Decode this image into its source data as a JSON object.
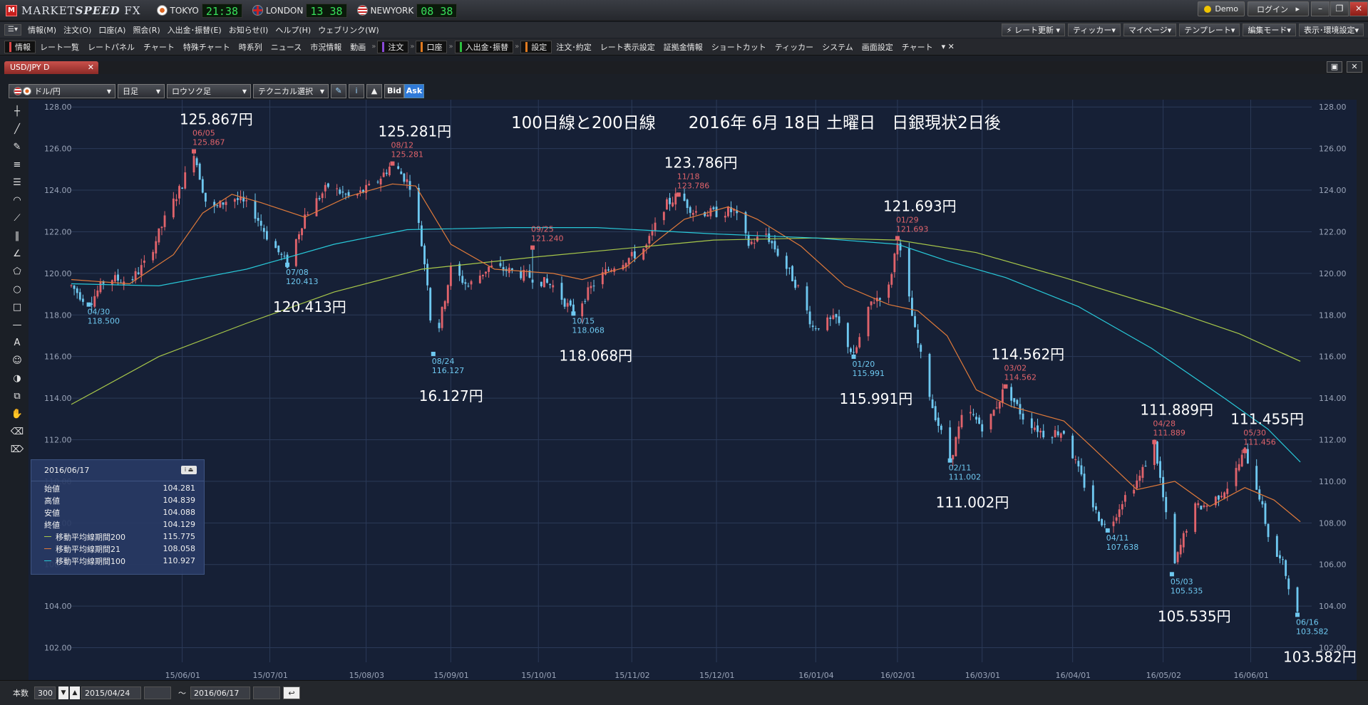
{
  "app": {
    "logo_text": "M",
    "brand_prefix": "MARKET",
    "brand_mid": "SPEED",
    "brand_suffix": " FX",
    "markets": [
      {
        "name": "TOKYO",
        "time": "21:38",
        "flag": "jp"
      },
      {
        "name": "LONDON",
        "time": "13 38",
        "flag": "uk"
      },
      {
        "name": "NEWYORK",
        "time": "08 38",
        "flag": "us"
      }
    ],
    "demo_label": "Demo",
    "login_label": "ログイン",
    "login_arrow": "▸",
    "window_buttons": [
      "–",
      "❐",
      "✕"
    ]
  },
  "menu": {
    "icon": "☰▾",
    "items": [
      "情報(M)",
      "注文(O)",
      "口座(A)",
      "照会(R)",
      "入出金･振替(E)",
      "お知らせ(I)",
      "ヘルプ(H)",
      "ウェブリンク(W)"
    ],
    "right_buttons": [
      "⚡ レート更新 ▾",
      "ティッカー▾",
      "マイページ▾",
      "テンプレート▾",
      "編集モード▾",
      "表示･環境設定▾"
    ]
  },
  "toolbar": {
    "groups": [
      {
        "label": "情報",
        "bar": "#e04848",
        "hl": true
      },
      {
        "label": "レート一覧"
      },
      {
        "label": "レートパネル"
      },
      {
        "label": "チャート"
      },
      {
        "label": "特殊チャート"
      },
      {
        "label": "時系列"
      },
      {
        "label": "ニュース"
      },
      {
        "label": "市況情報"
      },
      {
        "label": "動画"
      },
      {
        "label": "注文",
        "bar": "#8a4ad8",
        "hl": true,
        "sep": true
      },
      {
        "label": "口座",
        "bar": "#e07a20",
        "hl": true,
        "sep": true
      },
      {
        "label": "入出金･振替",
        "bar": "#2cc040",
        "hl": true,
        "sep": true
      },
      {
        "label": "設定",
        "bar": "#e07a20",
        "hl": true,
        "sep": true
      },
      {
        "label": "注文･約定"
      },
      {
        "label": "レート表示設定"
      },
      {
        "label": "証拠金情報"
      },
      {
        "label": "ショートカット"
      },
      {
        "label": "ティッカー"
      },
      {
        "label": "システム"
      },
      {
        "label": "画面設定"
      },
      {
        "label": "チャート"
      }
    ],
    "overflow": "▾  ✕"
  },
  "tab": {
    "label": "USD/JPY D",
    "close": "✕"
  },
  "tab_controls": [
    "▣",
    "✕"
  ],
  "controls": {
    "pair": "ドル/円",
    "interval": "日足",
    "chart_kind": "ロウソク足",
    "technical": "テクニカル選択",
    "draw_icon": "✎",
    "info_icon": "i",
    "volume_icon": "▲",
    "bid": "Bid",
    "ask": "Ask"
  },
  "left_tools": [
    {
      "name": "crosshair-tool",
      "glyph": "┼"
    },
    {
      "name": "trendline-tool",
      "glyph": "╱"
    },
    {
      "name": "pencil-tool",
      "glyph": "✎"
    },
    {
      "name": "horizontal-lines-tool",
      "glyph": "≡"
    },
    {
      "name": "multi-lines-tool",
      "glyph": "☰"
    },
    {
      "name": "arc-tool",
      "glyph": "◠"
    },
    {
      "name": "fan-tool",
      "glyph": "⟋"
    },
    {
      "name": "vertical-lines-tool",
      "glyph": "‖"
    },
    {
      "name": "angle-tool",
      "glyph": "∠"
    },
    {
      "name": "polygon-tool",
      "glyph": "⬠"
    },
    {
      "name": "circle-tool",
      "glyph": "○"
    },
    {
      "name": "rectangle-tool",
      "glyph": "□"
    },
    {
      "name": "line-tool",
      "glyph": "—"
    },
    {
      "name": "text-tool",
      "glyph": "A"
    },
    {
      "name": "icon-tool",
      "glyph": "☺"
    },
    {
      "name": "magnet-tool",
      "glyph": "◑"
    },
    {
      "name": "copy-tool",
      "glyph": "⧉"
    },
    {
      "name": "hand-tool",
      "glyph": "✋"
    },
    {
      "name": "eraser-tool",
      "glyph": "⌫"
    },
    {
      "name": "eraser-all-tool",
      "glyph": "⌦"
    }
  ],
  "info_panel": {
    "date": "2016/06/17",
    "header_icon": "i ⏏",
    "rows": [
      {
        "label": "始値",
        "value": "104.281"
      },
      {
        "label": "高値",
        "value": "104.839"
      },
      {
        "label": "安値",
        "value": "104.088"
      },
      {
        "label": "終値",
        "value": "104.129"
      },
      {
        "label": "移動平均線期間200",
        "value": "115.775",
        "color": "#a8c84a"
      },
      {
        "label": "移動平均線期間21",
        "value": "108.058",
        "color": "#e07a3a"
      },
      {
        "label": "移動平均線期間100",
        "value": "110.927",
        "color": "#28c8d8"
      }
    ]
  },
  "bottom": {
    "count_label": "本数",
    "count_value": "300",
    "from_date": "2015/04/24",
    "tilde": "〜",
    "to_date": "2016/06/17",
    "reset_icon": "↩"
  },
  "chart_data": {
    "type": "candlestick",
    "title": "100日線と200日線　　2016年 6月 18日 土曜日　日銀現状2日後",
    "ylim": [
      101.3,
      128.35
    ],
    "y_ticks": [
      "102.00",
      "104.00",
      "106.00",
      "108.00",
      "110.00",
      "112.00",
      "114.00",
      "116.00",
      "118.00",
      "120.00",
      "122.00",
      "124.00",
      "126.00",
      "128.00"
    ],
    "x_ticks": [
      {
        "label": "15/06/01",
        "day": 38
      },
      {
        "label": "15/07/01",
        "day": 68
      },
      {
        "label": "15/08/03",
        "day": 101
      },
      {
        "label": "15/09/01",
        "day": 130
      },
      {
        "label": "15/10/01",
        "day": 160
      },
      {
        "label": "15/11/02",
        "day": 192
      },
      {
        "label": "15/12/01",
        "day": 221
      },
      {
        "label": "16/01/04",
        "day": 255
      },
      {
        "label": "16/02/01",
        "day": 283
      },
      {
        "label": "16/03/01",
        "day": 312
      },
      {
        "label": "16/04/01",
        "day": 343
      },
      {
        "label": "16/05/02",
        "day": 374
      },
      {
        "label": "16/06/01",
        "day": 404
      }
    ],
    "x_domain": [
      0,
      420
    ],
    "price_path": [
      [
        0,
        119.4
      ],
      [
        6,
        118.5
      ],
      [
        12,
        119.8
      ],
      [
        20,
        119.6
      ],
      [
        26,
        120.6
      ],
      [
        32,
        122.6
      ],
      [
        38,
        124.3
      ],
      [
        42,
        125.867
      ],
      [
        47,
        122.9
      ],
      [
        55,
        123.7
      ],
      [
        62,
        123.1
      ],
      [
        67,
        121.8
      ],
      [
        74,
        120.413
      ],
      [
        80,
        122.8
      ],
      [
        88,
        124.2
      ],
      [
        96,
        123.6
      ],
      [
        104,
        124.3
      ],
      [
        110,
        125.281
      ],
      [
        117,
        124.1
      ],
      [
        122,
        119.6
      ],
      [
        124,
        116.127
      ],
      [
        130,
        120.2
      ],
      [
        136,
        119.4
      ],
      [
        143,
        120.3
      ],
      [
        151,
        120.1
      ],
      [
        158,
        119.8
      ],
      [
        165,
        119.4
      ],
      [
        172,
        118.068
      ],
      [
        180,
        119.7
      ],
      [
        186,
        120.4
      ],
      [
        192,
        120.8
      ],
      [
        197,
        121.3
      ],
      [
        203,
        123.2
      ],
      [
        208,
        123.786
      ],
      [
        213,
        123.0
      ],
      [
        220,
        122.9
      ],
      [
        227,
        123.0
      ],
      [
        232,
        121.4
      ],
      [
        238,
        121.9
      ],
      [
        244,
        120.5
      ],
      [
        249,
        119.3
      ],
      [
        254,
        117.4
      ],
      [
        262,
        117.8
      ],
      [
        268,
        115.991
      ],
      [
        274,
        118.6
      ],
      [
        280,
        119.3
      ],
      [
        283,
        121.693
      ],
      [
        289,
        117.2
      ],
      [
        295,
        113.6
      ],
      [
        301,
        111.002
      ],
      [
        306,
        113.5
      ],
      [
        313,
        112.5
      ],
      [
        320,
        114.562
      ],
      [
        326,
        113.1
      ],
      [
        333,
        112.3
      ],
      [
        340,
        112.4
      ],
      [
        345,
        110.5
      ],
      [
        351,
        108.5
      ],
      [
        355,
        107.638
      ],
      [
        360,
        109.1
      ],
      [
        366,
        110.2
      ],
      [
        371,
        111.889
      ],
      [
        375,
        108.3
      ],
      [
        377,
        105.535
      ],
      [
        384,
        108.7
      ],
      [
        390,
        108.9
      ],
      [
        397,
        109.9
      ],
      [
        402,
        111.455
      ],
      [
        407,
        109.3
      ],
      [
        411,
        106.8
      ],
      [
        415,
        106.0
      ],
      [
        419,
        104.1
      ],
      [
        420,
        103.582
      ],
      [
        421,
        104.129
      ]
    ],
    "series": [
      {
        "name": "移動平均線期間200",
        "color": "#a8c84a",
        "points": [
          [
            0,
            113.7
          ],
          [
            30,
            116.0
          ],
          [
            60,
            117.6
          ],
          [
            90,
            119.1
          ],
          [
            120,
            120.2
          ],
          [
            160,
            120.8
          ],
          [
            190,
            121.2
          ],
          [
            220,
            121.6
          ],
          [
            255,
            121.7
          ],
          [
            283,
            121.6
          ],
          [
            310,
            121.0
          ],
          [
            340,
            119.8
          ],
          [
            375,
            118.3
          ],
          [
            400,
            117.1
          ],
          [
            421,
            115.775
          ]
        ]
      },
      {
        "name": "移動平均線期間21",
        "color": "#e07a3a",
        "points": [
          [
            0,
            119.7
          ],
          [
            20,
            119.5
          ],
          [
            35,
            120.9
          ],
          [
            45,
            122.9
          ],
          [
            55,
            123.8
          ],
          [
            65,
            123.4
          ],
          [
            80,
            122.7
          ],
          [
            95,
            123.7
          ],
          [
            110,
            124.3
          ],
          [
            118,
            124.2
          ],
          [
            130,
            121.4
          ],
          [
            145,
            120.2
          ],
          [
            165,
            120.0
          ],
          [
            175,
            119.7
          ],
          [
            190,
            120.3
          ],
          [
            200,
            121.5
          ],
          [
            210,
            122.6
          ],
          [
            225,
            123.2
          ],
          [
            235,
            122.6
          ],
          [
            250,
            121.3
          ],
          [
            265,
            119.4
          ],
          [
            280,
            118.5
          ],
          [
            290,
            118.2
          ],
          [
            300,
            117.0
          ],
          [
            310,
            114.4
          ],
          [
            322,
            113.6
          ],
          [
            340,
            112.9
          ],
          [
            350,
            111.6
          ],
          [
            365,
            109.6
          ],
          [
            378,
            110.0
          ],
          [
            390,
            108.8
          ],
          [
            402,
            109.7
          ],
          [
            412,
            109.1
          ],
          [
            421,
            108.058
          ]
        ]
      },
      {
        "name": "移動平均線期間100",
        "color": "#28c8d8",
        "points": [
          [
            0,
            119.5
          ],
          [
            30,
            119.4
          ],
          [
            60,
            120.2
          ],
          [
            90,
            121.4
          ],
          [
            115,
            122.1
          ],
          [
            150,
            122.2
          ],
          [
            180,
            122.2
          ],
          [
            220,
            121.9
          ],
          [
            255,
            121.7
          ],
          [
            283,
            121.4
          ],
          [
            300,
            120.6
          ],
          [
            320,
            119.8
          ],
          [
            345,
            118.4
          ],
          [
            370,
            116.4
          ],
          [
            395,
            114.0
          ],
          [
            410,
            112.5
          ],
          [
            421,
            110.927
          ]
        ]
      }
    ],
    "annotations": [
      {
        "kind": "high",
        "date": "06/05",
        "value": "125.867",
        "big": "125.867円",
        "day": 42,
        "price": 125.867
      },
      {
        "kind": "low",
        "date": "04/30",
        "value": "118.500",
        "day": 6,
        "price": 118.5
      },
      {
        "kind": "low",
        "date": "07/08",
        "value": "120.413",
        "big": "120.413円",
        "day": 74,
        "price": 120.413
      },
      {
        "kind": "high",
        "date": "08/12",
        "value": "125.281",
        "big": "125.281円",
        "day": 110,
        "price": 125.281
      },
      {
        "kind": "low",
        "date": "08/24",
        "value": "116.127",
        "big": "16.127円",
        "day": 124,
        "price": 116.127
      },
      {
        "kind": "high",
        "date": "09/25",
        "value": "121.240",
        "day": 158,
        "price": 121.24
      },
      {
        "kind": "low",
        "date": "10/15",
        "value": "118.068",
        "big": "118.068円",
        "day": 172,
        "price": 118.068
      },
      {
        "kind": "high",
        "date": "11/18",
        "value": "123.786",
        "big": "123.786円",
        "day": 208,
        "price": 123.786
      },
      {
        "kind": "low",
        "date": "01/20",
        "value": "115.991",
        "big": "115.991円",
        "day": 268,
        "price": 115.991
      },
      {
        "kind": "high",
        "date": "01/29",
        "value": "121.693",
        "big": "121.693円",
        "day": 283,
        "price": 121.693
      },
      {
        "kind": "low",
        "date": "02/11",
        "value": "111.002",
        "big": "111.002円",
        "day": 301,
        "price": 111.002
      },
      {
        "kind": "high",
        "date": "03/02",
        "value": "114.562",
        "big": "114.562円",
        "day": 320,
        "price": 114.562
      },
      {
        "kind": "low",
        "date": "04/11",
        "value": "107.638",
        "day": 355,
        "price": 107.638
      },
      {
        "kind": "high",
        "date": "04/28",
        "value": "111.889",
        "big": "111.889円",
        "day": 371,
        "price": 111.889
      },
      {
        "kind": "low",
        "date": "05/03",
        "value": "105.535",
        "big": "105.535円",
        "day": 377,
        "price": 105.535
      },
      {
        "kind": "high",
        "date": "05/30",
        "value": "111.456",
        "big": "111.455円",
        "day": 402,
        "price": 111.456
      },
      {
        "kind": "low",
        "date": "06/16",
        "value": "103.582",
        "big": "103.582円",
        "day": 420,
        "price": 103.582
      }
    ],
    "up_color": "#e0636b",
    "down_color": "#6ec8f0",
    "grid": true
  }
}
